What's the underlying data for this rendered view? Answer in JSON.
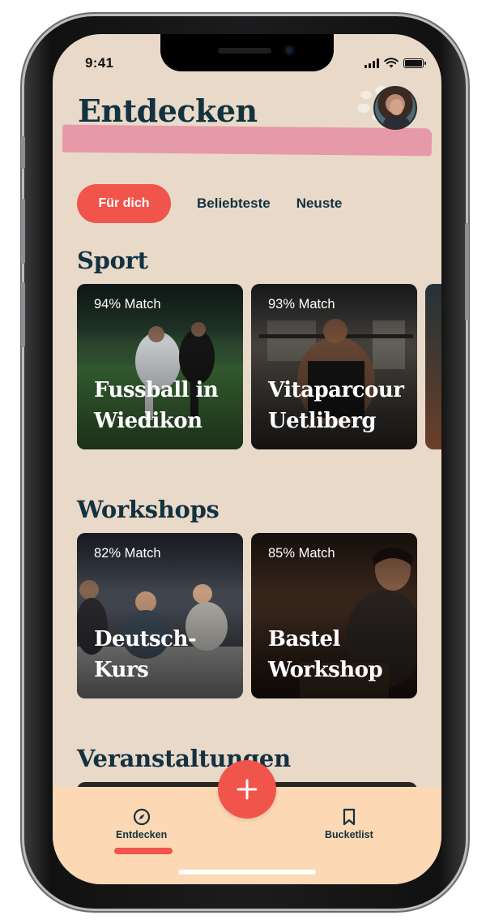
{
  "status_bar": {
    "time": "9:41"
  },
  "header": {
    "title": "Entdecken"
  },
  "tabs": [
    {
      "label": "Für dich",
      "active": true
    },
    {
      "label": "Beliebteste",
      "active": false
    },
    {
      "label": "Neuste",
      "active": false
    }
  ],
  "sections": [
    {
      "title": "Sport",
      "cards": [
        {
          "match": "94% Match",
          "title": "Fussball in Wiedikon"
        },
        {
          "match": "93% Match",
          "title": "Vitaparcour Uetliberg"
        }
      ]
    },
    {
      "title": "Workshops",
      "cards": [
        {
          "match": "82% Match",
          "title": "Deutsch-Kurs"
        },
        {
          "match": "85% Match",
          "title": "Bastel Workshop"
        }
      ]
    },
    {
      "title": "Veranstaltungen",
      "cards": []
    }
  ],
  "bottom_nav": {
    "items": [
      {
        "label": "Entdecken",
        "icon": "compass-icon",
        "active": true
      },
      {
        "label": "Bucketlist",
        "icon": "bookmark-icon",
        "active": false
      }
    ],
    "fab_icon": "plus-icon"
  },
  "colors": {
    "background": "#e9d9c9",
    "accent": "#f0544a",
    "heading": "#133240",
    "brush": "#e696a6",
    "nav_bg": "#fcd8b4"
  }
}
